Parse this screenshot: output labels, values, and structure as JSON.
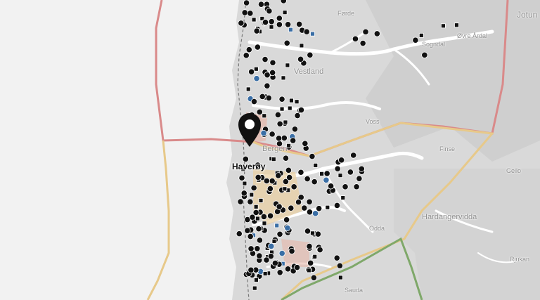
{
  "map": {
    "type": "terrain map with location markers",
    "colors": {
      "sea": "#f2f2f2",
      "land": "#d9d9d9",
      "water": "#ffffff",
      "border_red": "#d98a8a",
      "border_yellow": "#e7c98a",
      "border_green": "#7fa86a",
      "marker": "#111111",
      "marker_blue": "#3a6ea5",
      "coastal_dashes": "#777777"
    },
    "places": [
      {
        "name": "Førde",
        "size": "small"
      },
      {
        "name": "Vestland",
        "size": "normal"
      },
      {
        "name": "Sogndal",
        "size": "small"
      },
      {
        "name": "Øvre Årdal",
        "size": "small"
      },
      {
        "name": "Jotun",
        "size": "big"
      },
      {
        "name": "Voss",
        "size": "small"
      },
      {
        "name": "Bergen",
        "size": "normal"
      },
      {
        "name": "Finse",
        "size": "small"
      },
      {
        "name": "Geilo",
        "size": "small"
      },
      {
        "name": "Hardangervidda",
        "size": "normal"
      },
      {
        "name": "Odda",
        "size": "small"
      },
      {
        "name": "Sauda",
        "size": "small"
      },
      {
        "name": "Rjukan",
        "size": "small"
      }
    ],
    "selected_marker": {
      "label": "Haverøy",
      "icon": "map-pin-icon"
    }
  }
}
